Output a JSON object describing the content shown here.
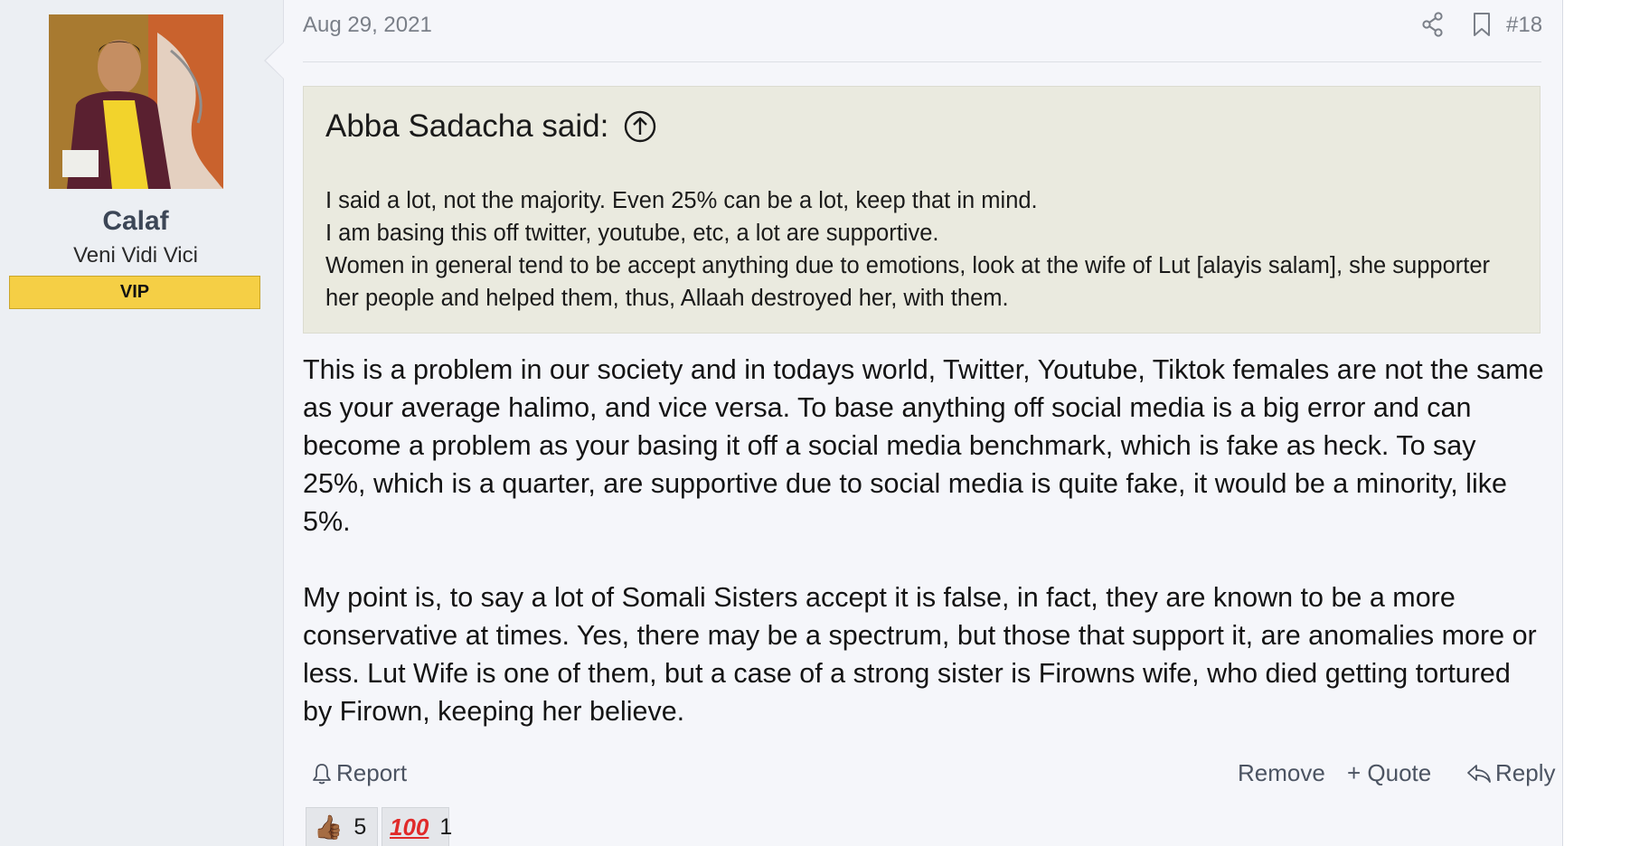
{
  "user": {
    "name": "Calaf",
    "title": "Veni Vidi Vici",
    "badge": "VIP"
  },
  "post": {
    "date": "Aug 29, 2021",
    "number": "#18",
    "quote": {
      "author_line": "Abba Sadacha said:",
      "lines": [
        "I said a lot, not the majority. Even 25% can be a lot, keep that in mind.",
        "I am basing this off twitter, youtube, etc, a lot are supportive.",
        "Women in general tend to be accept anything due to emotions, look at the wife of Lut [alayis salam], she supporter her people and helped them, thus, Allaah destroyed her, with them."
      ]
    },
    "paragraphs": [
      "This is a problem in our society and in todays world, Twitter, Youtube, Tiktok females are not the same as your average halimo, and vice versa. To base anything off social media is a big error and can become a problem as your basing it off a social media benchmark, which is fake as heck. To say 25%, which is a quarter, are supportive due to social media is quite fake, it would be a minority, like 5%.",
      "My point is, to say a lot of Somali Sisters accept it is false, in fact, they are known to be a more conservative at times. Yes, there may be a spectrum, but those that support it, are anomalies more or less. Lut Wife is one of them, but a case of a strong sister is Firowns wife, who died getting tortured by Firown, keeping her believe."
    ]
  },
  "actions": {
    "report": "Report",
    "remove": "Remove",
    "quote": "+ Quote",
    "reply": "Reply"
  },
  "reactions": [
    {
      "icon": "thumbs-up",
      "count": "5"
    },
    {
      "icon": "hundred-points",
      "count": "1"
    }
  ],
  "colors": {
    "vip_badge": "#f5cf45",
    "quote_bg": "#eaeadf",
    "user_column_bg": "#eceff3"
  }
}
